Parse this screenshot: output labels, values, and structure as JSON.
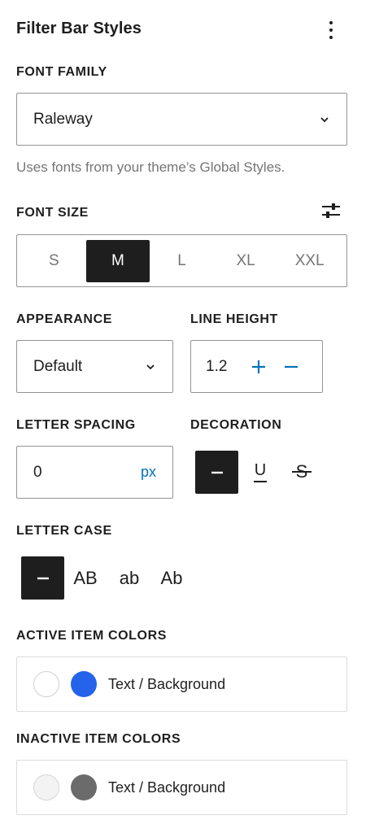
{
  "header": {
    "title": "Filter Bar Styles",
    "more_icon": "more-vertical-icon"
  },
  "font_family": {
    "label": "FONT FAMILY",
    "value": "Raleway",
    "help": "Uses fonts from your theme’s Global Styles."
  },
  "font_size": {
    "label": "FONT SIZE",
    "options": [
      "S",
      "M",
      "L",
      "XL",
      "XXL"
    ],
    "selected": "M",
    "settings_icon": "sliders-icon"
  },
  "appearance": {
    "label": "APPEARANCE",
    "value": "Default"
  },
  "line_height": {
    "label": "LINE HEIGHT",
    "value": "1.2",
    "increment": "+",
    "decrement": "–"
  },
  "letter_spacing": {
    "label": "LETTER SPACING",
    "value": "0",
    "unit": "px"
  },
  "decoration": {
    "label": "DECORATION",
    "options": [
      "none-icon",
      "underline-icon",
      "strikethrough-icon"
    ],
    "selected": "none-icon",
    "underline_glyph": "U",
    "strike_glyph": "S"
  },
  "letter_case": {
    "label": "LETTER CASE",
    "options": [
      "none",
      "AB",
      "ab",
      "Ab"
    ],
    "selected": "none"
  },
  "active_item_colors": {
    "label": "ACTIVE ITEM COLORS",
    "text": "Text / Background",
    "text_color": "#ffffff",
    "background_color": "#2563eb"
  },
  "inactive_item_colors": {
    "label": "INACTIVE ITEM COLORS",
    "text": "Text / Background",
    "text_color": "#f3f3f3",
    "background_color": "#6b6b6b"
  }
}
